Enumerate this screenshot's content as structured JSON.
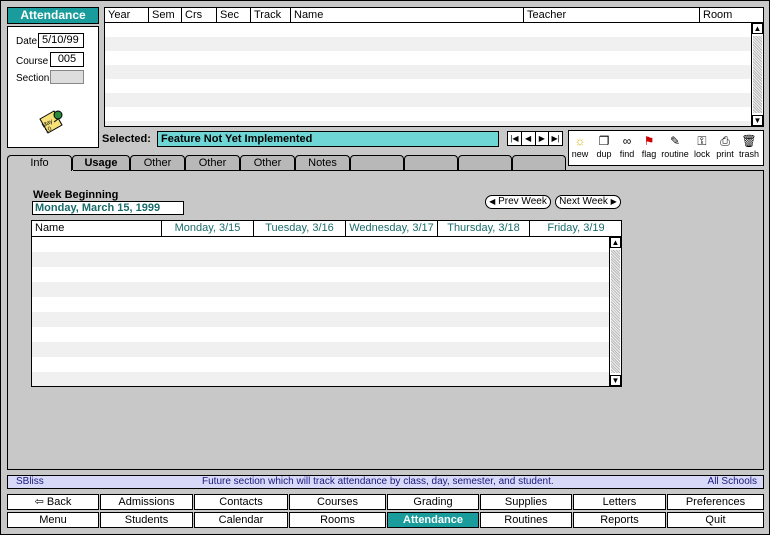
{
  "app": {
    "title_tab": "Attendance"
  },
  "left_panel": {
    "date_label": "Date",
    "date_value": "5/10/99",
    "course_label": "Course",
    "course_value": "005",
    "section_label": "Section",
    "section_value": "",
    "calendar_icon": "calendar-note-icon",
    "calendar_text": "May 10"
  },
  "course_table": {
    "columns": [
      "Year",
      "Sem",
      "Crs",
      "Sec",
      "Track",
      "Name",
      "Teacher",
      "Room"
    ],
    "rows": []
  },
  "selected": {
    "label": "Selected:",
    "value": "Feature Not Yet Implemented"
  },
  "record_nav": {
    "first_icon": "first-record-icon",
    "prev_icon": "prev-record-icon",
    "next_icon": "next-record-icon",
    "last_icon": "last-record-icon"
  },
  "toolbar": {
    "items": [
      {
        "label": "new",
        "icon": "lightbulb-icon"
      },
      {
        "label": "dup",
        "icon": "duplicate-icon"
      },
      {
        "label": "find",
        "icon": "glasses-icon"
      },
      {
        "label": "flag",
        "icon": "flag-icon"
      },
      {
        "label": "routine",
        "icon": "clipboard-icon"
      },
      {
        "label": "lock",
        "icon": "key-icon"
      },
      {
        "label": "print",
        "icon": "printer-icon"
      },
      {
        "label": "trash",
        "icon": "trash-icon"
      }
    ]
  },
  "tabs": [
    "Info",
    "Usage",
    "Other",
    "Other",
    "Other",
    "Notes",
    "",
    "",
    "",
    ""
  ],
  "week": {
    "heading": "Week Beginning",
    "value": "Monday, March 15, 1999",
    "prev_label": "Prev Week",
    "next_label": "Next Week"
  },
  "attendance_grid": {
    "columns": [
      "Name",
      "Monday, 3/15",
      "Tuesday, 3/16",
      "Wednesday, 3/17",
      "Thursday, 3/18",
      "Friday, 3/19"
    ],
    "rows": []
  },
  "status_bar": {
    "user": "SBliss",
    "message": "Future section which will track attendance by class, day, semester, and student.",
    "scope": "All Schools"
  },
  "nav_row1": [
    "Back",
    "Admissions",
    "Contacts",
    "Courses",
    "Grading",
    "Supplies",
    "Letters",
    "Preferences"
  ],
  "nav_row2": [
    "Menu",
    "Students",
    "Calendar",
    "Rooms",
    "Attendance",
    "Routines",
    "Reports",
    "Quit"
  ],
  "colors": {
    "accent": "#1a9c9c",
    "background": "#c8c8c8",
    "status_bar": "#d8d8f8",
    "status_text": "#1a1a80"
  }
}
